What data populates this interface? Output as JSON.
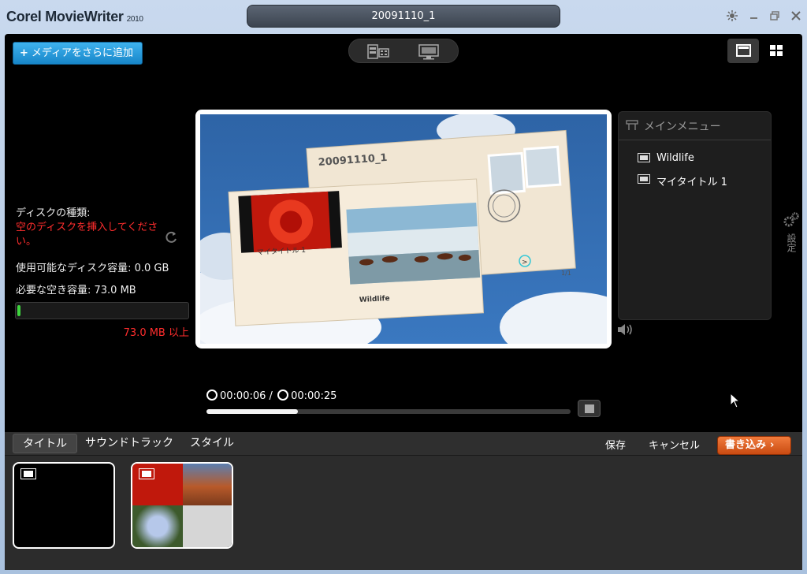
{
  "app": {
    "name": "Corel MovieWriter",
    "version": "2010"
  },
  "project": {
    "title": "20091110_1"
  },
  "toolbar": {
    "add_media_label": "メディアをさらに追加"
  },
  "disk": {
    "type_label": "ディスクの種類:",
    "type_warning": "空のディスクを挿入してください。",
    "available_label": "使用可能なディスク容量: 0.0 GB",
    "required_label": "必要な空き容量: 73.0 MB",
    "usage_fraction": 0.02,
    "limit_label": "73.0 MB 以上"
  },
  "preview": {
    "envelope_title": "20091110_1",
    "card_left_label": "マイタイトル 1",
    "card_right_label": "Wildlife",
    "page_indicator": "1/1",
    "next_glyph": ">"
  },
  "menu_panel": {
    "heading": "メインメニュー",
    "items": [
      {
        "label": "Wildlife"
      },
      {
        "label": "マイタイトル 1"
      }
    ]
  },
  "settings_label": "設定",
  "playback": {
    "current": "00:00:06",
    "separator": "/",
    "total": "00:00:25",
    "progress_fraction": 0.25
  },
  "bottom_tabs": [
    {
      "label": "タイトル",
      "active": true
    },
    {
      "label": "サウンドトラック",
      "active": false
    },
    {
      "label": "スタイル",
      "active": false
    }
  ],
  "actions": {
    "save_label": "保存",
    "cancel_label": "キャンセル",
    "burn_label": "書き込み"
  },
  "colors": {
    "accent_blue": "#1a8fd6",
    "burn_orange": "#e0611f",
    "warning_red": "#ff2d2d"
  }
}
